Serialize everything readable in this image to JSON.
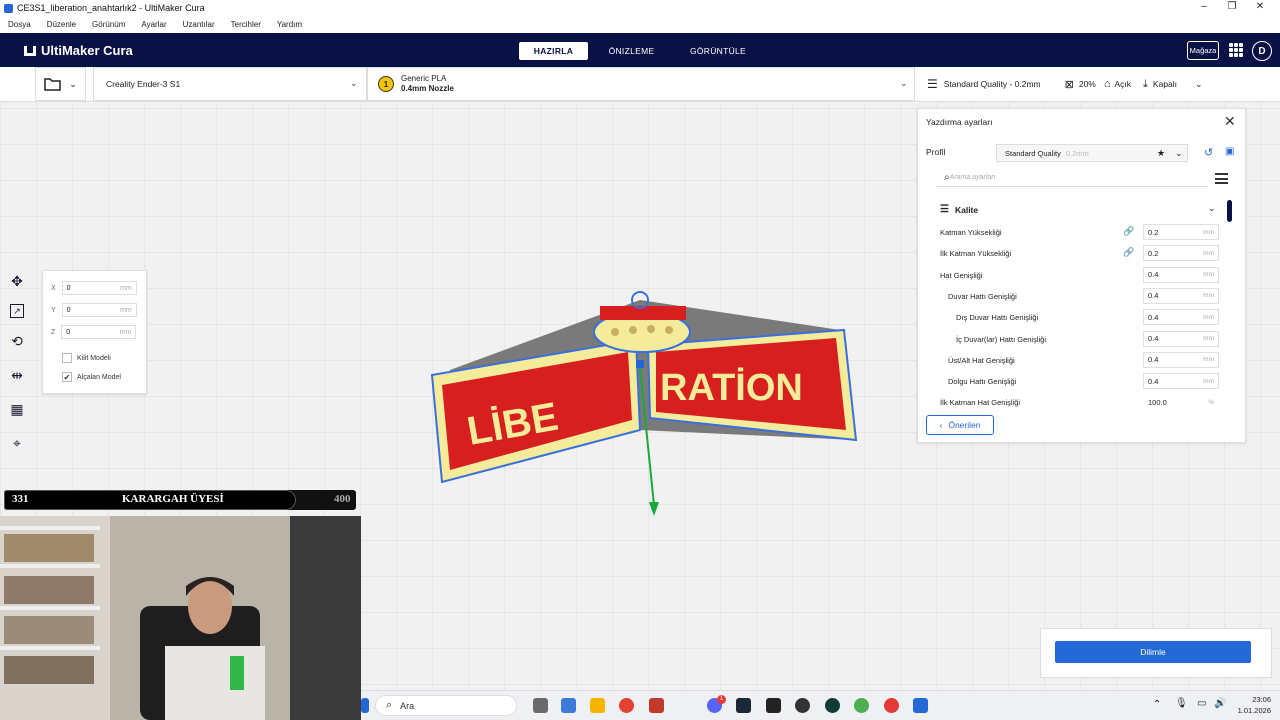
{
  "window": {
    "title": "CE3S1_liberation_anahtarlık2 - UltiMaker Cura"
  },
  "menu": [
    "Dosya",
    "Düzenle",
    "Görünüm",
    "Ayarlar",
    "Uzantılar",
    "Tercihler",
    "Yardım"
  ],
  "header": {
    "logo": "UltiMaker Cura",
    "stages": [
      "HAZIRLA",
      "ÖNIZLEME",
      "GÖRÜNTÜLE"
    ],
    "store": "Mağaza",
    "avatar": "D"
  },
  "toolbar": {
    "printer": "Creality Ender-3 S1",
    "material_index": "1",
    "material_name": "Generic PLA",
    "nozzle": "0.4mm Nozzle",
    "profile": "Standard Quality - 0.2mm",
    "infill": "20%",
    "support": "Açık",
    "adhesion": "Kapalı"
  },
  "move_panel": {
    "x_label": "X",
    "x_val": "0",
    "y_label": "Y",
    "y_val": "0",
    "z_label": "Z",
    "z_val": "0",
    "unit": "mm",
    "lock_label": "Kilit Modeli",
    "lock_checked": false,
    "drop_label": "Alçalan Model",
    "drop_checked": true
  },
  "settings": {
    "title": "Yazdırma ayarları",
    "profile_label": "Profil",
    "profile_value": "Standard Quality",
    "profile_suffix": "0.2mm",
    "search_placeholder": "Arama ayarları",
    "category": "Kalite",
    "rows": [
      {
        "label": "Katman Yüksekliği",
        "value": "0.2",
        "unit": "mm",
        "linked": true
      },
      {
        "label": "İlk Katman Yüksekliği",
        "value": "0.2",
        "unit": "mm",
        "linked": true
      },
      {
        "label": "Hat Genişliği",
        "value": "0.4",
        "unit": "mm"
      },
      {
        "label": "Duvar Hattı Genişliği",
        "value": "0.4",
        "unit": "mm"
      },
      {
        "label": "Dış Duvar Hattı Genişliği",
        "value": "0.4",
        "unit": "mm"
      },
      {
        "label": "İç Duvar(lar) Hattı Genişliği",
        "value": "0.4",
        "unit": "mm"
      },
      {
        "label": "Üst/Alt Hat Genişliği",
        "value": "0.4",
        "unit": "mm"
      },
      {
        "label": "Dolgu Hattı Genişliği",
        "value": "0.4",
        "unit": "mm"
      },
      {
        "label": "İlk Katman Hat Genişliği",
        "value": "100.0",
        "unit": "%"
      }
    ],
    "recommended": "Önerilen"
  },
  "slice_button": "Dilimle",
  "model_text": {
    "left": "LİBE",
    "right": "RATİON"
  },
  "overlay": {
    "left_num": "331",
    "title": "KARARGAH ÜYESİ",
    "right_num": "400",
    "progress": 0.83
  },
  "taskbar": {
    "search": "Ara",
    "time": "23:06",
    "date": "1.01.2026",
    "badge": "1"
  },
  "colors": {
    "navy": "#0a1145",
    "accent": "#2468d8",
    "model_red": "#d81f1f",
    "model_yellow": "#f4ec9b"
  }
}
